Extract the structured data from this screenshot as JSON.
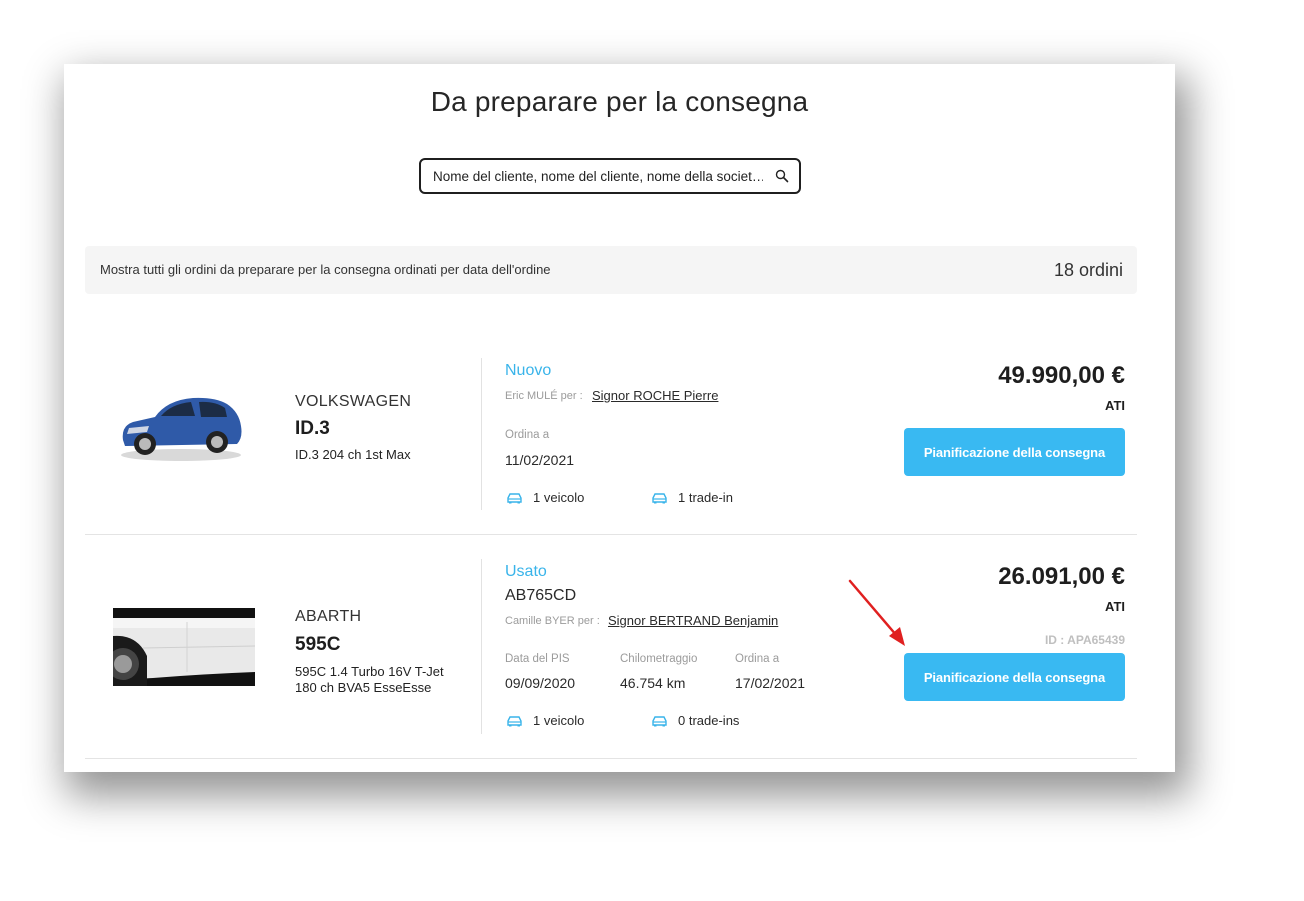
{
  "page": {
    "title": "Da preparare per la consegna",
    "search_placeholder": "Nome del cliente, nome del cliente, nome della societ…"
  },
  "summary": {
    "description": "Mostra tutti gli ordini da preparare per la consegna ordinati per data dell'ordine",
    "count": "18 ordini"
  },
  "orders": [
    {
      "brand": "VOLKSWAGEN",
      "model": "ID.3",
      "version": "ID.3 204 ch 1st Max",
      "condition": "Nuovo",
      "seller": "Eric MULÉ per :",
      "customer": "Signor ROCHE Pierre",
      "order_label": "Ordina a",
      "order_date": "11/02/2021",
      "vehicles": "1 veicolo",
      "tradeins": "1 trade-in",
      "price": "49.990,00 €",
      "price_type": "ATI",
      "button": "Pianificazione della consegna",
      "car_color": "#2f5aa8"
    },
    {
      "brand": "ABARTH",
      "model": "595C",
      "version_line1": "595C 1.4 Turbo 16V T-Jet",
      "version_line2": "180 ch BVA5 EsseEsse",
      "condition": "Usato",
      "plate": "AB765CD",
      "seller": "Camille BYER per :",
      "customer": "Signor BERTRAND Benjamin",
      "pis_label": "Data del PIS",
      "pis_date": "09/09/2020",
      "km_label": "Chilometraggio",
      "km": "46.754 km",
      "order_label": "Ordina a",
      "order_date": "17/02/2021",
      "vehicles": "1 veicolo",
      "tradeins": "0 trade-ins",
      "price": "26.091,00 €",
      "price_type": "ATI",
      "id": "ID : APA65439",
      "button": "Pianificazione della consegna",
      "car_color": "#e9e9e9"
    }
  ],
  "colors": {
    "accent": "#39b9f2",
    "condition": "#39b4ea",
    "annotation_arrow": "#e02020"
  }
}
